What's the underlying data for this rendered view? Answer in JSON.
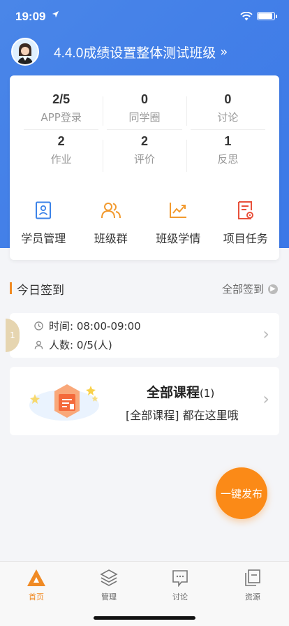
{
  "status_bar": {
    "time": "19:09",
    "location_icon": "location-arrow-icon",
    "wifi_icon": "wifi-icon",
    "battery_icon": "battery-icon"
  },
  "class_header": {
    "title": "4.4.0成绩设置整体测试班级",
    "chevron": "»"
  },
  "stats": [
    {
      "value": "2/5",
      "label": "APP登录"
    },
    {
      "value": "0",
      "label": "同学圈"
    },
    {
      "value": "0",
      "label": "讨论"
    },
    {
      "value": "2",
      "label": "作业"
    },
    {
      "value": "2",
      "label": "评价"
    },
    {
      "value": "1",
      "label": "反思"
    }
  ],
  "actions": [
    {
      "label": "学员管理",
      "icon": "student-card-icon",
      "color": "#3b82e8"
    },
    {
      "label": "班级群",
      "icon": "group-icon",
      "color": "#f29a2e"
    },
    {
      "label": "班级学情",
      "icon": "trend-chart-icon",
      "color": "#f29a2e"
    },
    {
      "label": "项目任务",
      "icon": "task-doc-icon",
      "color": "#e8513b"
    }
  ],
  "checkin_section": {
    "title": "今日签到",
    "more_label": "全部签到"
  },
  "checkin_card": {
    "stub": "1",
    "time_text": "时间: 08:00-09:00",
    "people_text": "人数: 0/5(人)"
  },
  "course_card": {
    "title": "全部课程",
    "count": "(1)",
    "subtitle": "[全部课程] 都在这里哦"
  },
  "fab": {
    "label": "一键发布"
  },
  "tabs": [
    {
      "label": "首页",
      "icon": "home-triangle-icon",
      "active": true
    },
    {
      "label": "管理",
      "icon": "layers-icon",
      "active": false
    },
    {
      "label": "讨论",
      "icon": "chat-icon",
      "active": false
    },
    {
      "label": "资源",
      "icon": "files-icon",
      "active": false
    }
  ],
  "colors": {
    "primary_blue": "#3b78e7",
    "accent_orange": "#fb8a17"
  }
}
